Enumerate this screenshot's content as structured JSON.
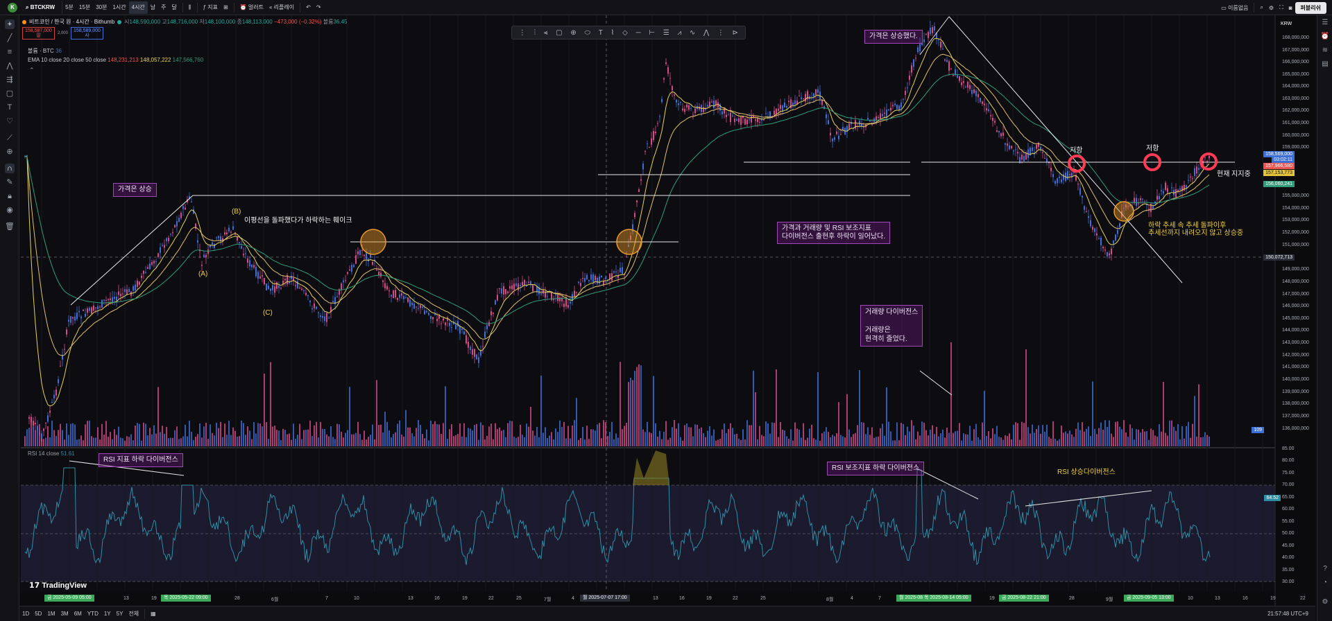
{
  "toolbar": {
    "symbol": "BTCKRW",
    "intervals": [
      "5분",
      "15분",
      "30분",
      "1시간",
      "4시간",
      "날",
      "주",
      "달"
    ],
    "active_interval": "4시간",
    "indicators_label": "지표",
    "alert_label": "얼러트",
    "replay_label": "리플레이",
    "layout_name": "이름없음",
    "publish_label": "퍼블리쉬",
    "user_initial": "K"
  },
  "legend": {
    "title": "비트코인 / 한국 원 · 4시간 · Bithumb",
    "ohlc": {
      "o_label": "시",
      "o": "148,590,000",
      "h_label": "고",
      "h": "148,716,000",
      "l_label": "저",
      "l": "148,100,000",
      "c_label": "종",
      "c": "148,113,000",
      "chg": "−473,000 (−0.32%)",
      "vol_label": "볼륨",
      "vol": "36.45"
    },
    "sell_price": "158,587,000",
    "sell_label": "팔",
    "spread": "2,000",
    "buy_price": "158,589,000",
    "buy_label": "사",
    "volume_row": "볼륨 · BTC",
    "volume_value": "36",
    "ema_label": "EMA 10 close 20 close 50 close",
    "ema10": "148,231,213",
    "ema20": "148,057,222",
    "ema50": "147,566,760",
    "currency": "KRW",
    "rsi_label": "RSI 14 close",
    "rsi_value": "51.61"
  },
  "notes": {
    "price_up_left": "가격은 상승",
    "price_up_right": "가격은 상승했다.",
    "fake_break": "이평선을 돌파했다가 하락하는 훼이크",
    "divergence_box_line1": "가격과 거래량 및 RSI 보조지표",
    "divergence_box_line2": "다이버전스 출현후 하락이 일어났다.",
    "volume_div_title": "거래량 다이버전스",
    "volume_div_line1": "거래량은",
    "volume_div_line2": "현격히 줄었다.",
    "resistance1": "저항",
    "resistance2": "저항",
    "current_support": "현재 지지중",
    "trend_break_line1": "하락 추세 속 추세 돌파이후",
    "trend_break_line2": "추세선까지 내려오지 않고 상승중",
    "rsi_div_left": "RSI 지표 하락 다이버전스",
    "rsi_div_mid": "RSI 보조지표 하락 다이버전스",
    "rsi_div_right": "RSI 상승다이버전스",
    "wave_a": "(A)",
    "wave_b": "(B)",
    "wave_c": "(C)"
  },
  "price_axis": [
    "168,000,000",
    "167,000,000",
    "166,000,000",
    "165,000,000",
    "164,000,000",
    "163,000,000",
    "162,000,000",
    "161,000,000",
    "160,000,000",
    "159,000,000",
    "155,000,000",
    "154,000,000",
    "153,000,000",
    "152,000,000",
    "151,000,000",
    "149,000,000",
    "148,000,000",
    "147,000,000",
    "146,000,000",
    "145,000,000",
    "144,000,000",
    "143,000,000",
    "142,000,000",
    "141,000,000",
    "140,000,000",
    "139,000,000",
    "138,000,000",
    "137,000,000",
    "136,000,000"
  ],
  "price_tags": {
    "last": "158,569,000",
    "timer": "03:02:11",
    "ema_a": "157,966,580",
    "ema_b": "157,153,773",
    "ema_c": "156,060,241",
    "crosshair": "150,072,713",
    "vol": "109"
  },
  "rsi_axis": [
    "85.00",
    "80.00",
    "75.00",
    "70.00",
    "65.00",
    "60.00",
    "55.00",
    "50.00",
    "45.00",
    "40.00",
    "35.00",
    "30.00"
  ],
  "rsi_tag": "64.52",
  "time_axis": [
    "13",
    "19",
    "28",
    "6월",
    "7",
    "10",
    "13",
    "16",
    "19",
    "22",
    "25",
    "7월",
    "4",
    "13",
    "16",
    "19",
    "22",
    "25",
    "8월",
    "4",
    "7",
    "19",
    "28",
    "9월",
    "10",
    "13",
    "16",
    "19",
    "22"
  ],
  "time_tags": {
    "t1": "금 2025-05-09  05:00",
    "t2": "목 2025-05-22  09:00",
    "t3": "월 2025-07-07  17:00",
    "t4": "월 2025-08  목 2025-08-14  05:00",
    "t5": "금 2025-08-22  21:00",
    "t6": "금 2025-09-05  13:00"
  },
  "bottom": {
    "ranges": [
      "1D",
      "5D",
      "1M",
      "3M",
      "6M",
      "YTD",
      "1Y",
      "5Y",
      "전체"
    ],
    "clock": "21:57:48 UTC+9",
    "brand": "TradingView"
  },
  "colors": {
    "up": "#d64a8a",
    "down": "#3c6fd8",
    "ema10": "#e6d35a",
    "ema50": "#2f9e78",
    "rsi": "#2d8fa5",
    "note": "#a148bb"
  }
}
